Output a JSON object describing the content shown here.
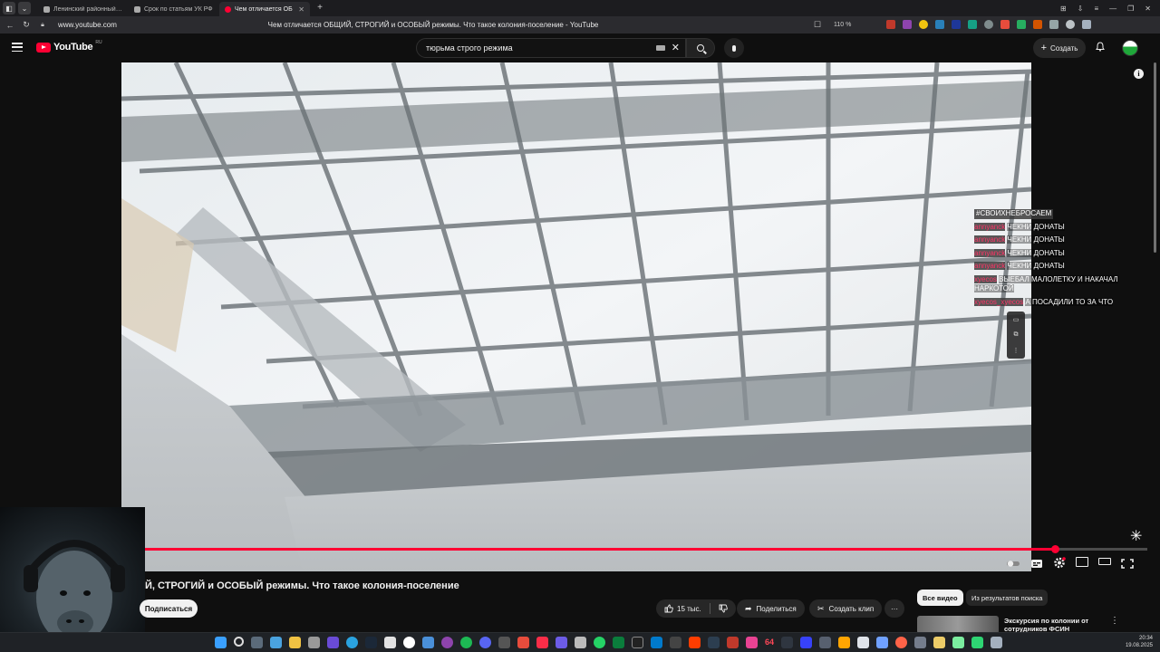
{
  "browser": {
    "tabs": [
      {
        "label": "Ленинский районный суд",
        "active": false
      },
      {
        "label": "Срок по статьям УК РФ",
        "active": false
      },
      {
        "label": "Чем отличается ОБ",
        "active": true
      }
    ],
    "url": "www.youtube.com",
    "page_title": "Чем отличается ОБЩИЙ, СТРОГИЙ и ОСОБЫЙ режимы. Что такое колония-поселение - YouTube",
    "zoom": "110 %"
  },
  "masthead": {
    "logo_text": "YouTube",
    "country": "RU",
    "search_value": "тюрьма строго режима",
    "create_label": "Создать"
  },
  "chat": {
    "hashtag": "#СВОИХНЕБРОСАЕМ",
    "messages": [
      {
        "user": "annyanck",
        "text": "ЧЕКНИ ДОНАТЫ"
      },
      {
        "user": "annyanck",
        "text": "ЧЕКНИ ДОНАТЫ"
      },
      {
        "user": "annyanck",
        "text": "ЧЕКНИ ДОНАТЫ"
      },
      {
        "user": "annyanck",
        "text": "ЧЕКНИ ДОНАТЫ"
      },
      {
        "user": "xyecos",
        "text": "ВЫЕБАЛ МАЛОЛЕТКУ И НАКАЧАЛ НАРКОТОЙ"
      },
      {
        "user": "xyecos_xyecos",
        "text": "А ПОСАДИЛИ ТО ЗА ЧТО"
      }
    ]
  },
  "player": {
    "progress": 0.908
  },
  "video": {
    "title": "Й, СТРОГИЙ и ОСОБЫЙ режимы. Что такое колония-поселение",
    "subscribe_label": "Подписаться",
    "likes": "15 тыс.",
    "share_label": "Поделиться",
    "clip_label": "Создать клип",
    "more_label": "···"
  },
  "related": {
    "filters": [
      "Все видео",
      "Из результатов поиска"
    ],
    "first_title": "Экскурсия по колонии от сотрудников ФСИН"
  },
  "taskbar": {
    "time": "20:34",
    "date": "19.08.2025",
    "badge": "64"
  },
  "colors": {
    "accent": "#ff0033",
    "background": "#0f0f0f",
    "chat_user": "#ff3366"
  }
}
